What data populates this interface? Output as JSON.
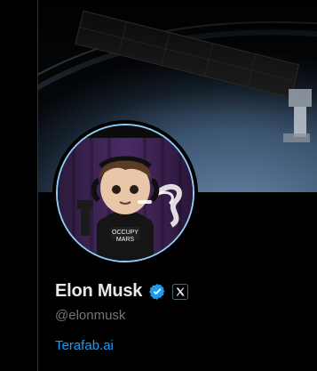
{
  "profile": {
    "display_name": "Elon Musk",
    "handle": "@elonmusk",
    "website": "Terafab.ai",
    "verified_icon": "verified-badge-icon",
    "affiliate_icon": "x-logo-icon"
  },
  "banner": {
    "image": "satellite-over-earth"
  },
  "avatar": {
    "image": "cartoon-figure-smoking",
    "shirt_text_line1": "OCCUPY",
    "shirt_text_line2": "MARS"
  },
  "colors": {
    "background": "#000000",
    "text_primary": "#e7e9ea",
    "text_secondary": "#71767b",
    "link": "#1d9bf0",
    "verified": "#1d9bf0",
    "avatar_ring": "#8ecdf8"
  }
}
